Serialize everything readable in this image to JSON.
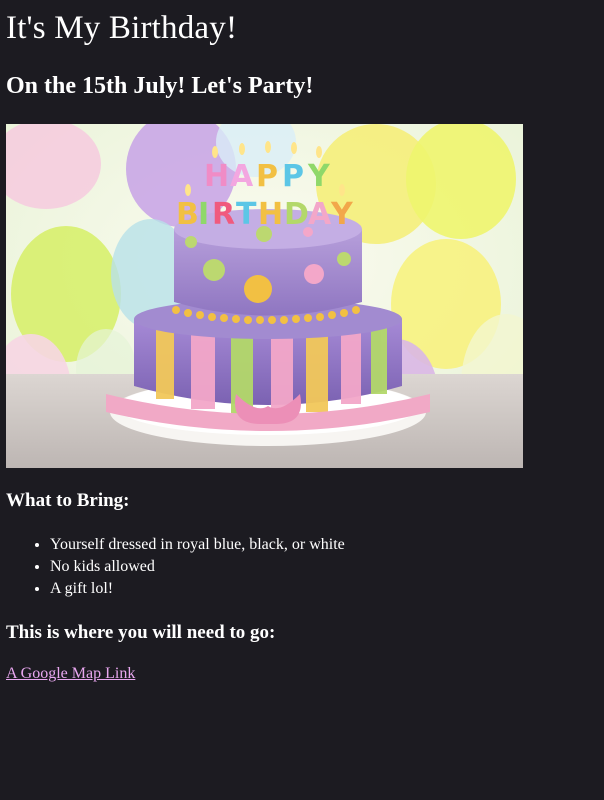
{
  "header": {
    "title": "It's My Birthday!",
    "subtitle": "On the 15th July! Let's Party!"
  },
  "hero": {
    "image_description": "Two-tier purple birthday cake with yellow and pink stripes, colorful HAPPY BIRTHDAY candles, pastel balloons in the background",
    "candle_text_top": "HAPPY",
    "candle_text_bottom": "BIRTHDAY"
  },
  "bring": {
    "heading": "What to Bring:",
    "items": [
      "Yourself dressed in royal blue, black, or white",
      "No kids allowed",
      "A gift lol!"
    ]
  },
  "location": {
    "heading": "This is where you will need to go:",
    "link_text": "A Google Map Link"
  },
  "colors": {
    "background": "#1c1b21",
    "text": "#ffffff",
    "link": "#e9a7f0"
  }
}
